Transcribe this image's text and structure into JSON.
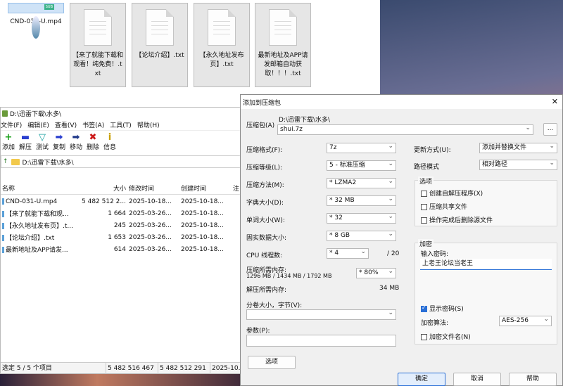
{
  "desktop": {
    "files": [
      {
        "label": "CND-031-U.mp4",
        "selected": true,
        "kind": "video",
        "badge": "SUB"
      },
      {
        "label": "【来了就能下载和观看！纯免费！.txt"
      },
      {
        "label": "【论坛介绍】.txt"
      },
      {
        "label": "【永久地址发布页】.txt"
      },
      {
        "label": "最新地址及APP请发邮箱自动获取！！！.txt"
      }
    ]
  },
  "fm": {
    "title": "D:\\迅雷下载\\水多\\",
    "menu": [
      "文件(F)",
      "编辑(E)",
      "查看(V)",
      "书签(A)",
      "工具(T)",
      "帮助(H)"
    ],
    "toolbar": [
      {
        "label": "添加",
        "icon": "+",
        "color": "#1aa01a"
      },
      {
        "label": "解压",
        "icon": "▬",
        "color": "#2a3fcf"
      },
      {
        "label": "测试",
        "icon": "▽",
        "color": "#1aa0a0"
      },
      {
        "label": "复制",
        "icon": "➡",
        "color": "#2a3fcf"
      },
      {
        "label": "移动",
        "icon": "➡",
        "color": "#223a8a"
      },
      {
        "label": "删除",
        "icon": "✖",
        "color": "#cc1a1a"
      },
      {
        "label": "信息",
        "icon": "i",
        "color": "#c8a000"
      }
    ],
    "address": "D:\\迅雷下载\\水多\\",
    "columns": [
      "名称",
      "大小",
      "修改时间",
      "创建时间",
      "注"
    ],
    "rows": [
      {
        "name": "CND-031-U.mp4",
        "size": "5 482 512 2...",
        "mtime": "2025-10-18...",
        "ctime": "2025-10-18..."
      },
      {
        "name": "【来了就能下载和观...",
        "size": "1 664",
        "mtime": "2025-03-26...",
        "ctime": "2025-10-18..."
      },
      {
        "name": "【永久地址发布页】.t...",
        "size": "245",
        "mtime": "2025-03-26...",
        "ctime": "2025-10-18..."
      },
      {
        "name": "【论坛介绍】.txt",
        "size": "1 653",
        "mtime": "2025-03-26...",
        "ctime": "2025-10-18..."
      },
      {
        "name": "最新地址及APP请发...",
        "size": "614",
        "mtime": "2025-03-26...",
        "ctime": "2025-10-18..."
      }
    ],
    "status": [
      "选定 5 / 5 个项目",
      "5 482 516 467",
      "5 482 512 291",
      "2025-10..."
    ]
  },
  "dlg": {
    "title": "添加到压缩包",
    "archive_label": "压缩包(A)",
    "archive_path": "D:\\迅雷下载\\水多\\",
    "archive_name": "shui.7z",
    "browse": "...",
    "format_label": "压缩格式(F):",
    "format": "7z",
    "level_label": "压缩等级(L):",
    "level": "5 - 标准压缩",
    "method_label": "压缩方法(M):",
    "method": "* LZMA2",
    "dict_label": "字典大小(D):",
    "dict": "* 32 MB",
    "word_label": "单词大小(W):",
    "word": "* 32",
    "solid_label": "固实数据大小:",
    "solid": "* 8 GB",
    "cpu_label": "CPU 线程数:",
    "cpu": "* 4",
    "cpu_total": "/ 20",
    "mem_label": "压缩所需内存:",
    "mem_values": "1296 MB / 1434 MB / 1792 MB",
    "mem_pct": "* 80%",
    "demem_label": "解压所需内存:",
    "demem": "34 MB",
    "split_label": "分卷大小，字节(V):",
    "param_label": "参数(P):",
    "options_btn": "选项",
    "update_label": "更新方式(U):",
    "update": "添加并替换文件",
    "path_label": "路径模式",
    "path": "相对路径",
    "opt_title": "选项",
    "opt_sfx": "创建自解压程序(X)",
    "opt_shared": "压缩共享文件",
    "opt_delete": "操作完成后删除源文件",
    "enc_title": "加密",
    "pwd_label": "输入密码:",
    "pwd": "上老王论坛当老王",
    "show_pwd": "显示密码(S)",
    "algo_label": "加密算法:",
    "algo": "AES-256",
    "enc_names": "加密文件名(N)",
    "ok": "确定",
    "cancel": "取消",
    "help": "帮助"
  }
}
